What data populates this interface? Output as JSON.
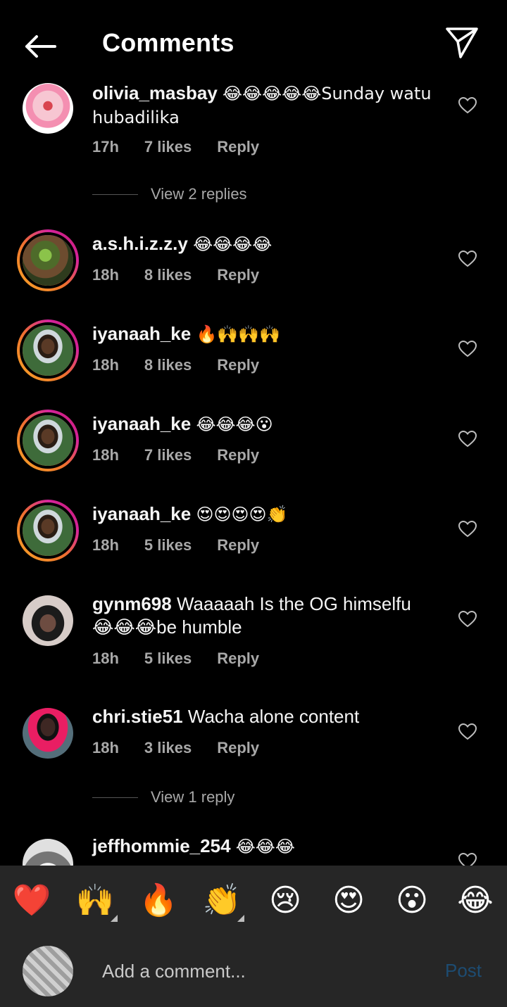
{
  "header": {
    "title": "Comments",
    "back_icon": "back-arrow-icon",
    "send_icon": "send-icon"
  },
  "comments": [
    {
      "username": "olivia_masbay",
      "text": "😂😂😂😂😂Sunday watu hubadilika",
      "time": "17h",
      "likes": "7 likes",
      "reply": "Reply",
      "has_story_ring": false
    },
    {
      "username": "a.s.h.i.z.z.y",
      "text": "😂😂😂😂",
      "time": "18h",
      "likes": "8 likes",
      "reply": "Reply",
      "has_story_ring": true
    },
    {
      "username": "iyanaah_ke",
      "text": "🔥🙌🙌🙌",
      "time": "18h",
      "likes": "8 likes",
      "reply": "Reply",
      "has_story_ring": true
    },
    {
      "username": "iyanaah_ke",
      "text": "😂😂😂😮",
      "time": "18h",
      "likes": "7 likes",
      "reply": "Reply",
      "has_story_ring": true
    },
    {
      "username": "iyanaah_ke",
      "text": "😍😍😍😍👏",
      "time": "18h",
      "likes": "5 likes",
      "reply": "Reply",
      "has_story_ring": true
    },
    {
      "username": "gynm698",
      "text": "Waaaaah Is the OG himselfu 😂😂😂be humble",
      "time": "18h",
      "likes": "5 likes",
      "reply": "Reply",
      "has_story_ring": false
    },
    {
      "username": "chri.stie51",
      "text": "Wacha alone content",
      "time": "18h",
      "likes": "3 likes",
      "reply": "Reply",
      "has_story_ring": false
    },
    {
      "username": "jeffhommie_254",
      "text": "😂😂😂",
      "has_story_ring": false
    }
  ],
  "view_replies": [
    "View 2 replies",
    "View 1 reply"
  ],
  "reactions": [
    "❤️",
    "🙌",
    "🔥",
    "👏",
    "😢",
    "😍",
    "😮",
    "😂"
  ],
  "composer": {
    "placeholder": "Add a comment...",
    "post_label": "Post",
    "post_color": "#1d4c72"
  }
}
